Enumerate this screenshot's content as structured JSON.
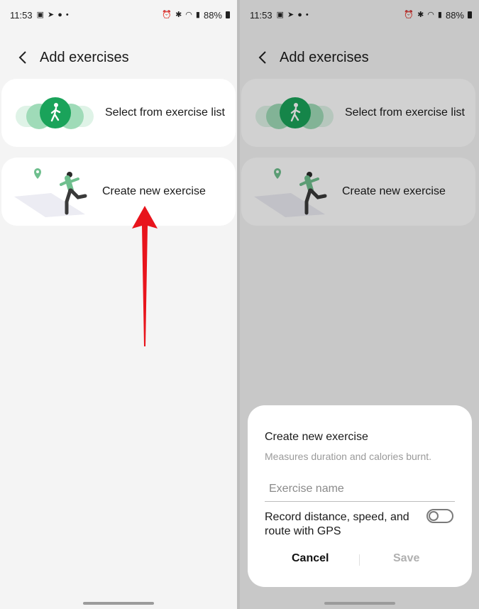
{
  "status": {
    "time": "11:53",
    "battery": "88%"
  },
  "screen": {
    "title": "Add exercises",
    "options": [
      {
        "label": "Select from exercise list"
      },
      {
        "label": "Create new exercise"
      }
    ]
  },
  "dialog": {
    "title": "Create new exercise",
    "description": "Measures duration and calories burnt.",
    "name_placeholder": "Exercise name",
    "gps_label": "Record distance, speed, and route with GPS",
    "gps_enabled": false,
    "cancel_label": "Cancel",
    "save_label": "Save"
  },
  "colors": {
    "accent_green": "#1aa35a",
    "arrow_red": "#e8141c"
  }
}
